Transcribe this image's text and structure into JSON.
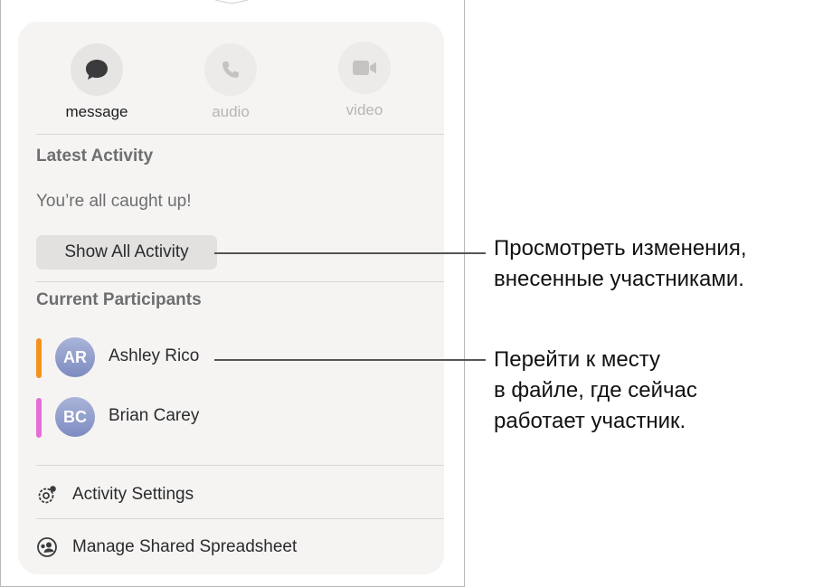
{
  "communications": [
    {
      "label": "message",
      "icon": "message-bubble-icon",
      "enabled": true
    },
    {
      "label": "audio",
      "icon": "phone-icon",
      "enabled": false
    },
    {
      "label": "video",
      "icon": "video-camera-icon",
      "enabled": false
    }
  ],
  "latest_activity": {
    "heading": "Latest Activity",
    "status": "You’re all caught up!",
    "button_label": "Show All Activity"
  },
  "participants": {
    "heading": "Current Participants",
    "items": [
      {
        "initials": "AR",
        "name": "Ashley Rico",
        "color": "#f5921e"
      },
      {
        "initials": "BC",
        "name": "Brian Carey",
        "color": "#e56ed6"
      }
    ]
  },
  "menu": {
    "activity_settings": "Activity Settings",
    "manage_shared": "Manage Shared Spreadsheet"
  },
  "callouts": {
    "activity": [
      "Просмотреть изменения,",
      "внесенные участниками."
    ],
    "participant": [
      "Перейти к месту",
      "в файле, где сейчас",
      "работает участник."
    ]
  }
}
